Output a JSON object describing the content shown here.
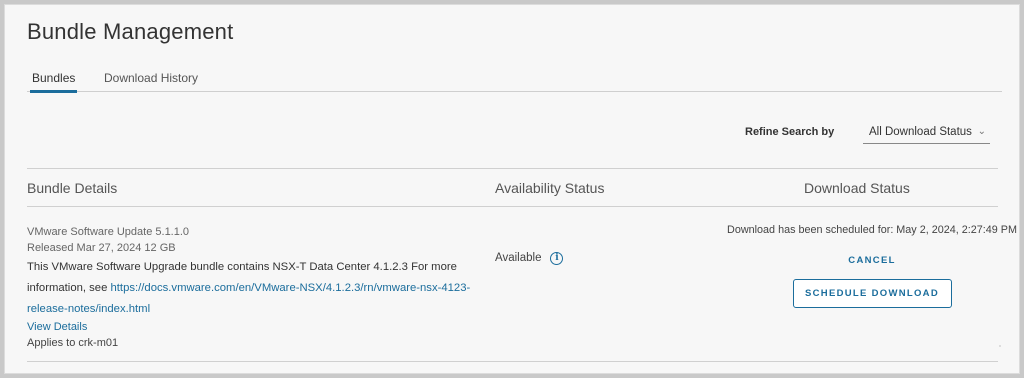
{
  "page": {
    "title": "Bundle Management"
  },
  "tabs": [
    {
      "label": "Bundles",
      "active": true
    },
    {
      "label": "Download History",
      "active": false
    }
  ],
  "filter": {
    "label": "Refine Search by",
    "selected": "All Download Status"
  },
  "table": {
    "columns": [
      "Bundle Details",
      "Availability Status",
      "Download Status"
    ],
    "rows": [
      {
        "name": "VMware Software Update 5.1.1.0",
        "released": "Released Mar 27, 2024 12 GB",
        "description_prefix": "This VMware Software Upgrade bundle contains NSX-T Data Center 4.1.2.3 For more information, see ",
        "description_link": "https://docs.vmware.com/en/VMware-NSX/4.1.2.3/rn/vmware-nsx-4123-release-notes/index.html",
        "view_details": "View Details",
        "applies_to": "Applies to crk-m01",
        "availability": "Available",
        "download_status": "Download has been scheduled for: May 2, 2024, 2:27:49 PM",
        "cancel_label": "CANCEL",
        "schedule_label": "SCHEDULE DOWNLOAD"
      }
    ]
  },
  "colors": {
    "accent": "#1b6d9c",
    "background": "#f7f7f7",
    "border": "#d0d0d0"
  },
  "icons": {
    "availability_info": "info-icon",
    "dropdown": "chevron-down-icon"
  }
}
